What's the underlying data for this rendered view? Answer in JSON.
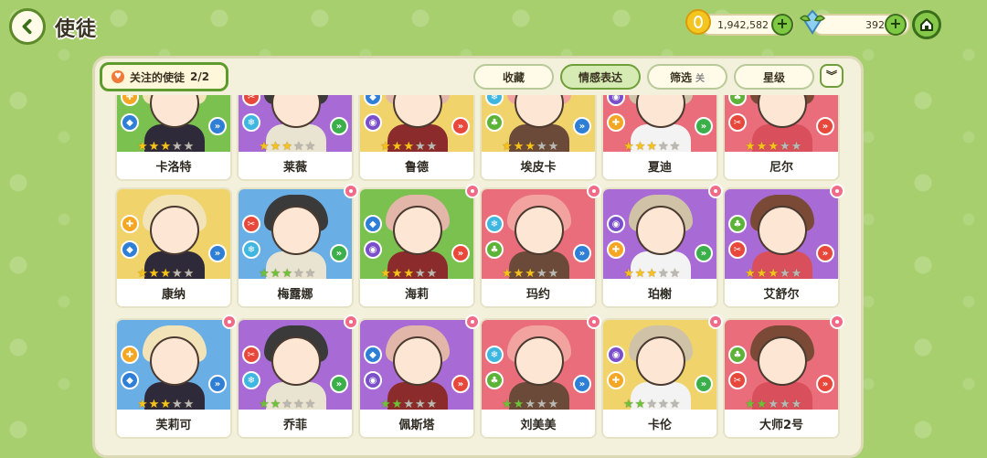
{
  "header": {
    "title": "使徒",
    "coins": "1,942,582",
    "gems": "392"
  },
  "panel": {
    "follow_label": "关注的使徒",
    "follow_count": "2/2",
    "tabs": [
      {
        "label": "收藏",
        "sub": ""
      },
      {
        "label": "情感表达",
        "sub": ""
      },
      {
        "label": "筛选",
        "sub": "关"
      },
      {
        "label": "星级",
        "sub": ""
      }
    ]
  },
  "colors": {
    "gold_star": "#f6c21b",
    "grey_star": "#b9b9b9",
    "green_star": "#6cc23a"
  },
  "characters": [
    {
      "name": "卡洛特",
      "bg": "#7bc14f",
      "stars": 3,
      "star_color": "gold",
      "flower": false
    },
    {
      "name": "莱薇",
      "bg": "#a86bd6",
      "stars": 3,
      "star_color": "gold",
      "flower": false
    },
    {
      "name": "鲁德",
      "bg": "#f0d36b",
      "stars": 3,
      "star_color": "gold",
      "flower": false
    },
    {
      "name": "埃皮卡",
      "bg": "#f0d36b",
      "stars": 3,
      "star_color": "gold",
      "flower": false
    },
    {
      "name": "夏迪",
      "bg": "#ea6d7c",
      "stars": 3,
      "star_color": "gold",
      "flower": false
    },
    {
      "name": "尼尔",
      "bg": "#ea6d7c",
      "stars": 3,
      "star_color": "gold",
      "flower": false
    },
    {
      "name": "康纳",
      "bg": "#f0d36b",
      "stars": 3,
      "star_color": "gold",
      "flower": false
    },
    {
      "name": "梅露娜",
      "bg": "#6aaee6",
      "stars": 3,
      "star_color": "green",
      "flower": true
    },
    {
      "name": "海莉",
      "bg": "#7bc14f",
      "stars": 3,
      "star_color": "gold",
      "flower": true
    },
    {
      "name": "玛约",
      "bg": "#ea6d7c",
      "stars": 3,
      "star_color": "gold",
      "flower": true
    },
    {
      "name": "珀榭",
      "bg": "#a86bd6",
      "stars": 3,
      "star_color": "gold",
      "flower": true
    },
    {
      "name": "艾舒尔",
      "bg": "#a86bd6",
      "stars": 3,
      "star_color": "gold",
      "flower": true
    },
    {
      "name": "芙莉可",
      "bg": "#6aaee6",
      "stars": 3,
      "star_color": "gold",
      "flower": true
    },
    {
      "name": "乔菲",
      "bg": "#a86bd6",
      "stars": 2,
      "star_color": "green",
      "flower": true
    },
    {
      "name": "佩斯塔",
      "bg": "#a86bd6",
      "stars": 2,
      "star_color": "green",
      "flower": true
    },
    {
      "name": "刘美美",
      "bg": "#ea6d7c",
      "stars": 2,
      "star_color": "green",
      "flower": true
    },
    {
      "name": "卡伦",
      "bg": "#f0d36b",
      "stars": 2,
      "star_color": "green",
      "flower": true
    },
    {
      "name": "大师2号",
      "bg": "#ea6d7c",
      "stars": 2,
      "star_color": "green",
      "flower": true
    }
  ]
}
